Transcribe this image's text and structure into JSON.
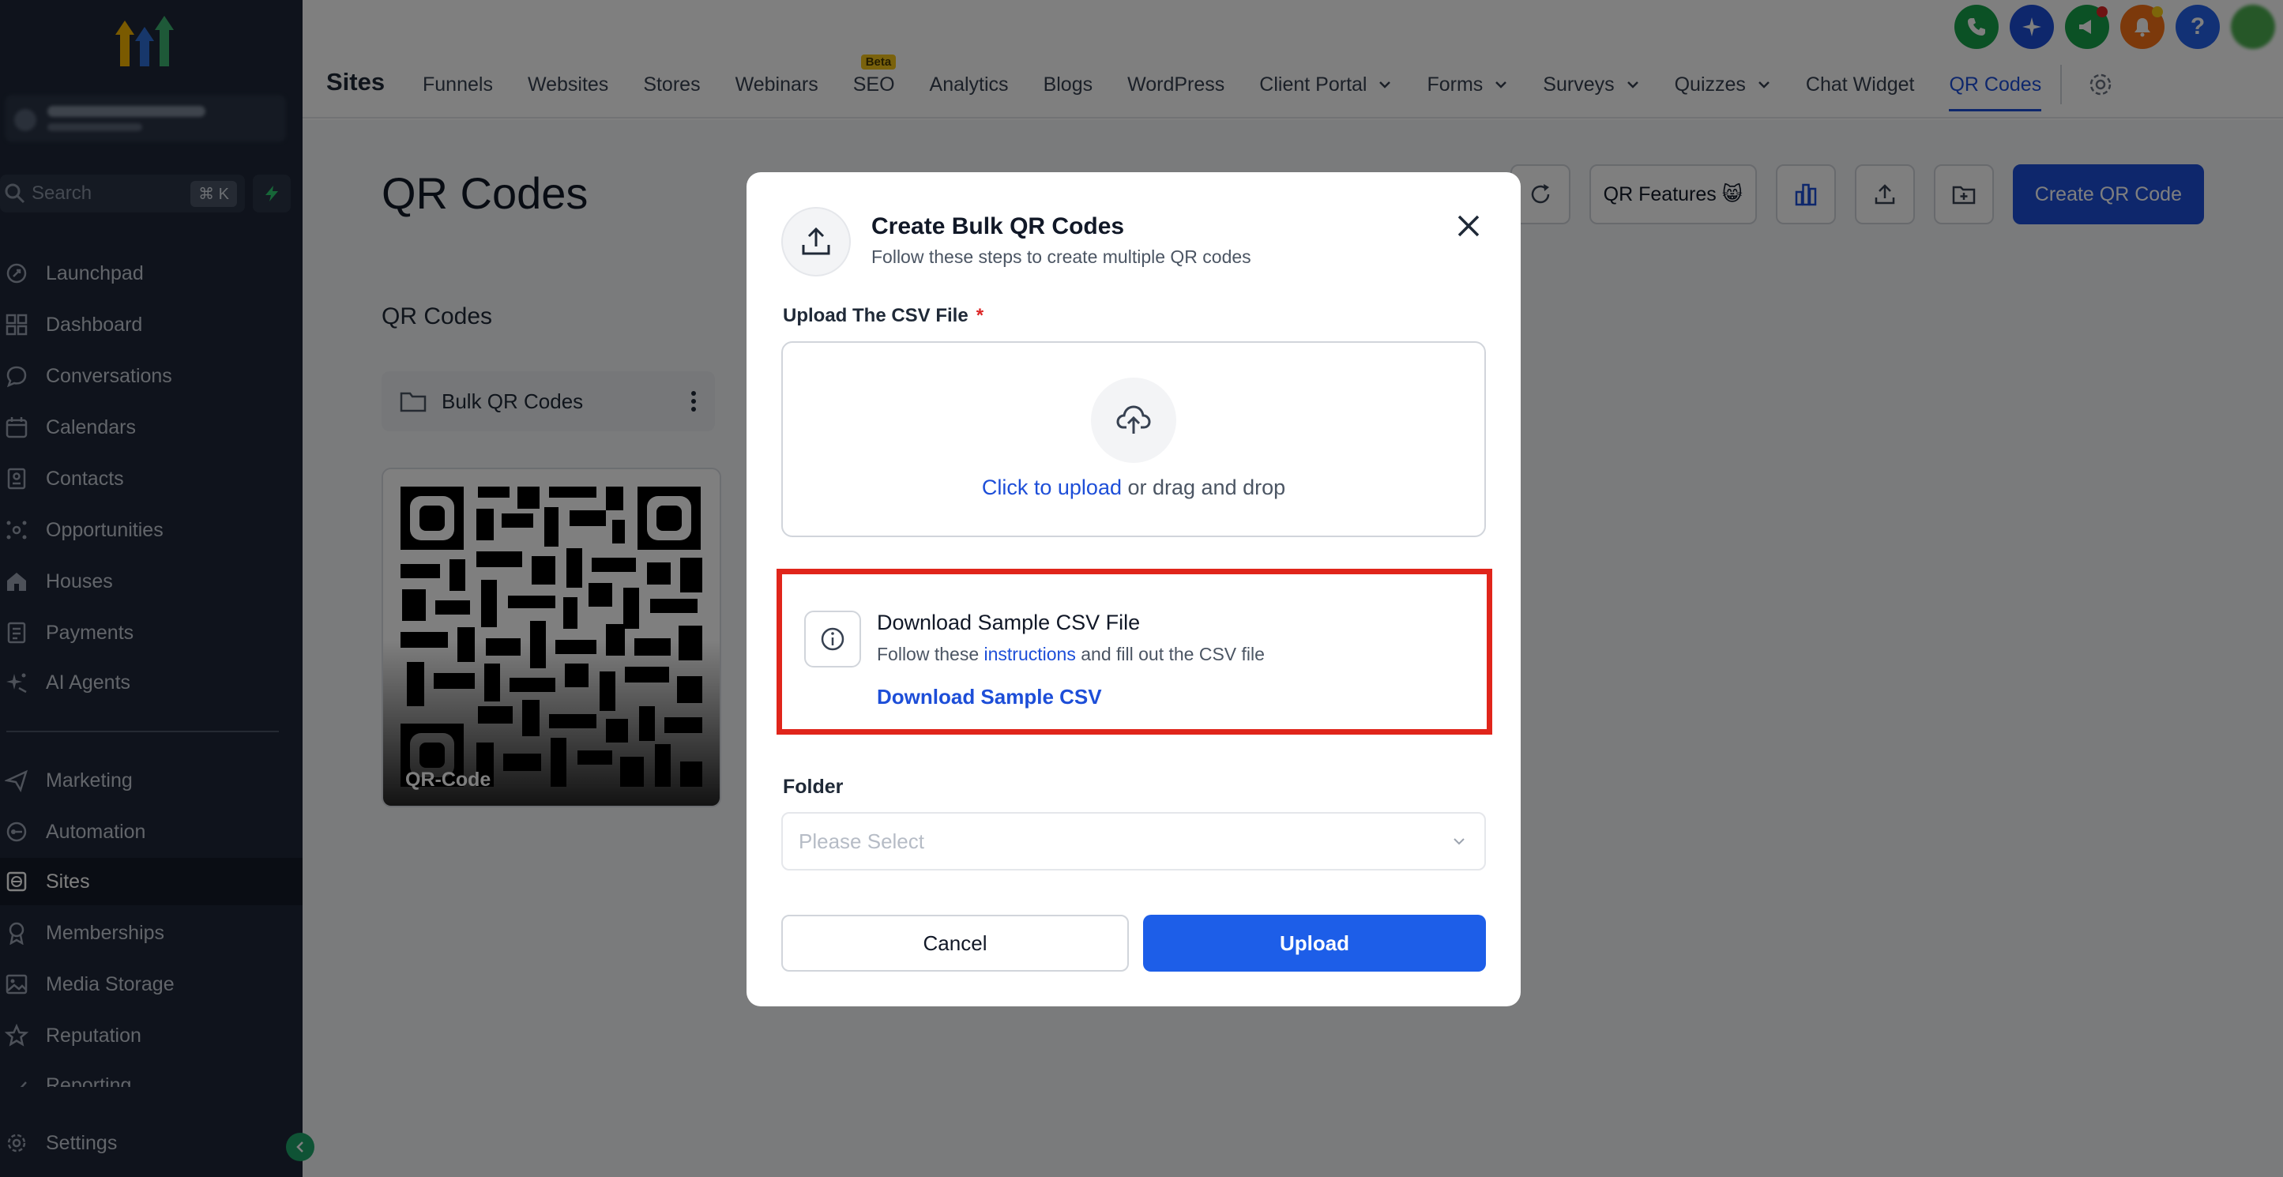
{
  "sidebar": {
    "search_placeholder": "Search",
    "search_shortcut": "⌘ K",
    "items": [
      {
        "label": "Launchpad",
        "icon": "rocket-icon"
      },
      {
        "label": "Dashboard",
        "icon": "dashboard-grid-icon"
      },
      {
        "label": "Conversations",
        "icon": "chat-bubble-icon"
      },
      {
        "label": "Calendars",
        "icon": "calendar-icon"
      },
      {
        "label": "Contacts",
        "icon": "contacts-icon"
      },
      {
        "label": "Opportunities",
        "icon": "opportunities-icon"
      },
      {
        "label": "Houses",
        "icon": "house-icon"
      },
      {
        "label": "Payments",
        "icon": "payments-icon"
      },
      {
        "label": "AI Agents",
        "icon": "ai-sparkle-icon"
      },
      {
        "label": "Marketing",
        "icon": "marketing-send-icon"
      },
      {
        "label": "Automation",
        "icon": "automation-icon"
      },
      {
        "label": "Sites",
        "icon": "globe-icon",
        "active": true
      },
      {
        "label": "Memberships",
        "icon": "membership-badge-icon"
      },
      {
        "label": "Media Storage",
        "icon": "image-icon"
      },
      {
        "label": "Reputation",
        "icon": "star-icon"
      },
      {
        "label": "Reporting",
        "icon": "trend-icon"
      },
      {
        "label": "Settings",
        "icon": "gear-icon"
      }
    ]
  },
  "topbar": {
    "title": "Sites",
    "beta_badge": "Beta",
    "tabs": [
      {
        "label": "Funnels"
      },
      {
        "label": "Websites"
      },
      {
        "label": "Stores"
      },
      {
        "label": "Webinars"
      },
      {
        "label": "SEO"
      },
      {
        "label": "Analytics"
      },
      {
        "label": "Blogs"
      },
      {
        "label": "WordPress"
      },
      {
        "label": "Client Portal"
      },
      {
        "label": "Forms"
      },
      {
        "label": "Surveys"
      },
      {
        "label": "Quizzes"
      },
      {
        "label": "Chat Widget"
      },
      {
        "label": "QR Codes"
      }
    ]
  },
  "main": {
    "page_title": "QR Codes",
    "features_button": "QR Features 😸",
    "create_button": "Create QR Code",
    "section_label": "QR Codes",
    "folder_name": "Bulk QR Codes",
    "qr_item_name": "QR-Code"
  },
  "modal": {
    "title": "Create Bulk QR Codes",
    "subtitle": "Follow these steps to create multiple QR codes",
    "upload_label": "Upload The CSV File",
    "required_mark": "*",
    "upload_link": "Click to upload",
    "upload_rest": " or drag and drop",
    "sample_title": "Download Sample CSV File",
    "sample_sub_pre": "Follow these ",
    "sample_sub_link": "instructions",
    "sample_sub_post": " and fill out the CSV file",
    "sample_download": "Download Sample CSV",
    "folder_label": "Folder",
    "folder_placeholder": "Please Select",
    "cancel_button": "Cancel",
    "upload_button": "Upload"
  },
  "colors": {
    "sidebar_bg": "#1e2738",
    "primary": "#1d4ed8",
    "highlight_border": "#e0251b"
  }
}
